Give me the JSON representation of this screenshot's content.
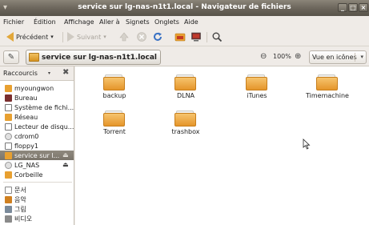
{
  "window": {
    "title": "service sur lg-nas-n1t1.local - Navigateur de fichiers"
  },
  "menu": [
    {
      "label": "Fichier",
      "u": "F"
    },
    {
      "label": "Édition",
      "u": "É"
    },
    {
      "label": "Affichage",
      "u": "A"
    },
    {
      "label": "Aller à",
      "u": "l"
    },
    {
      "label": "Signets",
      "u": "S"
    },
    {
      "label": "Onglets",
      "u": "O"
    },
    {
      "label": "Aide",
      "u": "d"
    }
  ],
  "toolbar": {
    "back": "Précédent",
    "forward": "Suivant"
  },
  "location": {
    "crumb": "service sur lg-nas-n1t1.local",
    "zoom": "100%",
    "view": "Vue en icônes"
  },
  "sidebar": {
    "header": "Raccourcis",
    "items": [
      {
        "label": "myoungwon",
        "icon": "home-icon",
        "color": "#e8a030"
      },
      {
        "label": "Bureau",
        "icon": "desktop-icon",
        "color": "#7a2e2e"
      },
      {
        "label": "Système de fichi...",
        "icon": "drive-icon",
        "color": "#9a9a9a"
      },
      {
        "label": "Réseau",
        "icon": "network-icon",
        "color": "#e8a030"
      },
      {
        "label": "Lecteur de disqu...",
        "icon": "drive-icon",
        "color": "#9a9a9a"
      },
      {
        "label": "cdrom0",
        "icon": "cdrom-icon",
        "color": "#bdbdbd"
      },
      {
        "label": "floppy1",
        "icon": "floppy-icon",
        "color": "#9a9a9a"
      },
      {
        "label": "service sur l...",
        "icon": "network-share-icon",
        "color": "#e8a030",
        "selected": true
      },
      {
        "label": "LG_NAS",
        "icon": "network-share-icon",
        "color": "#bdbdbd"
      },
      {
        "label": "Corbeille",
        "icon": "trash-icon",
        "color": "#e8a030"
      },
      {
        "label": "문서",
        "icon": "documents-icon",
        "color": "#b0b0b0"
      },
      {
        "label": "음악",
        "icon": "music-icon",
        "color": "#d08020"
      },
      {
        "label": "그림",
        "icon": "pictures-icon",
        "color": "#7a8a9a"
      },
      {
        "label": "비디오",
        "icon": "video-icon",
        "color": "#8a8a8a"
      }
    ]
  },
  "files": [
    {
      "name": "backup"
    },
    {
      "name": "DLNA"
    },
    {
      "name": "iTunes"
    },
    {
      "name": "Timemachine"
    },
    {
      "name": "Torrent"
    },
    {
      "name": "trashbox"
    }
  ]
}
